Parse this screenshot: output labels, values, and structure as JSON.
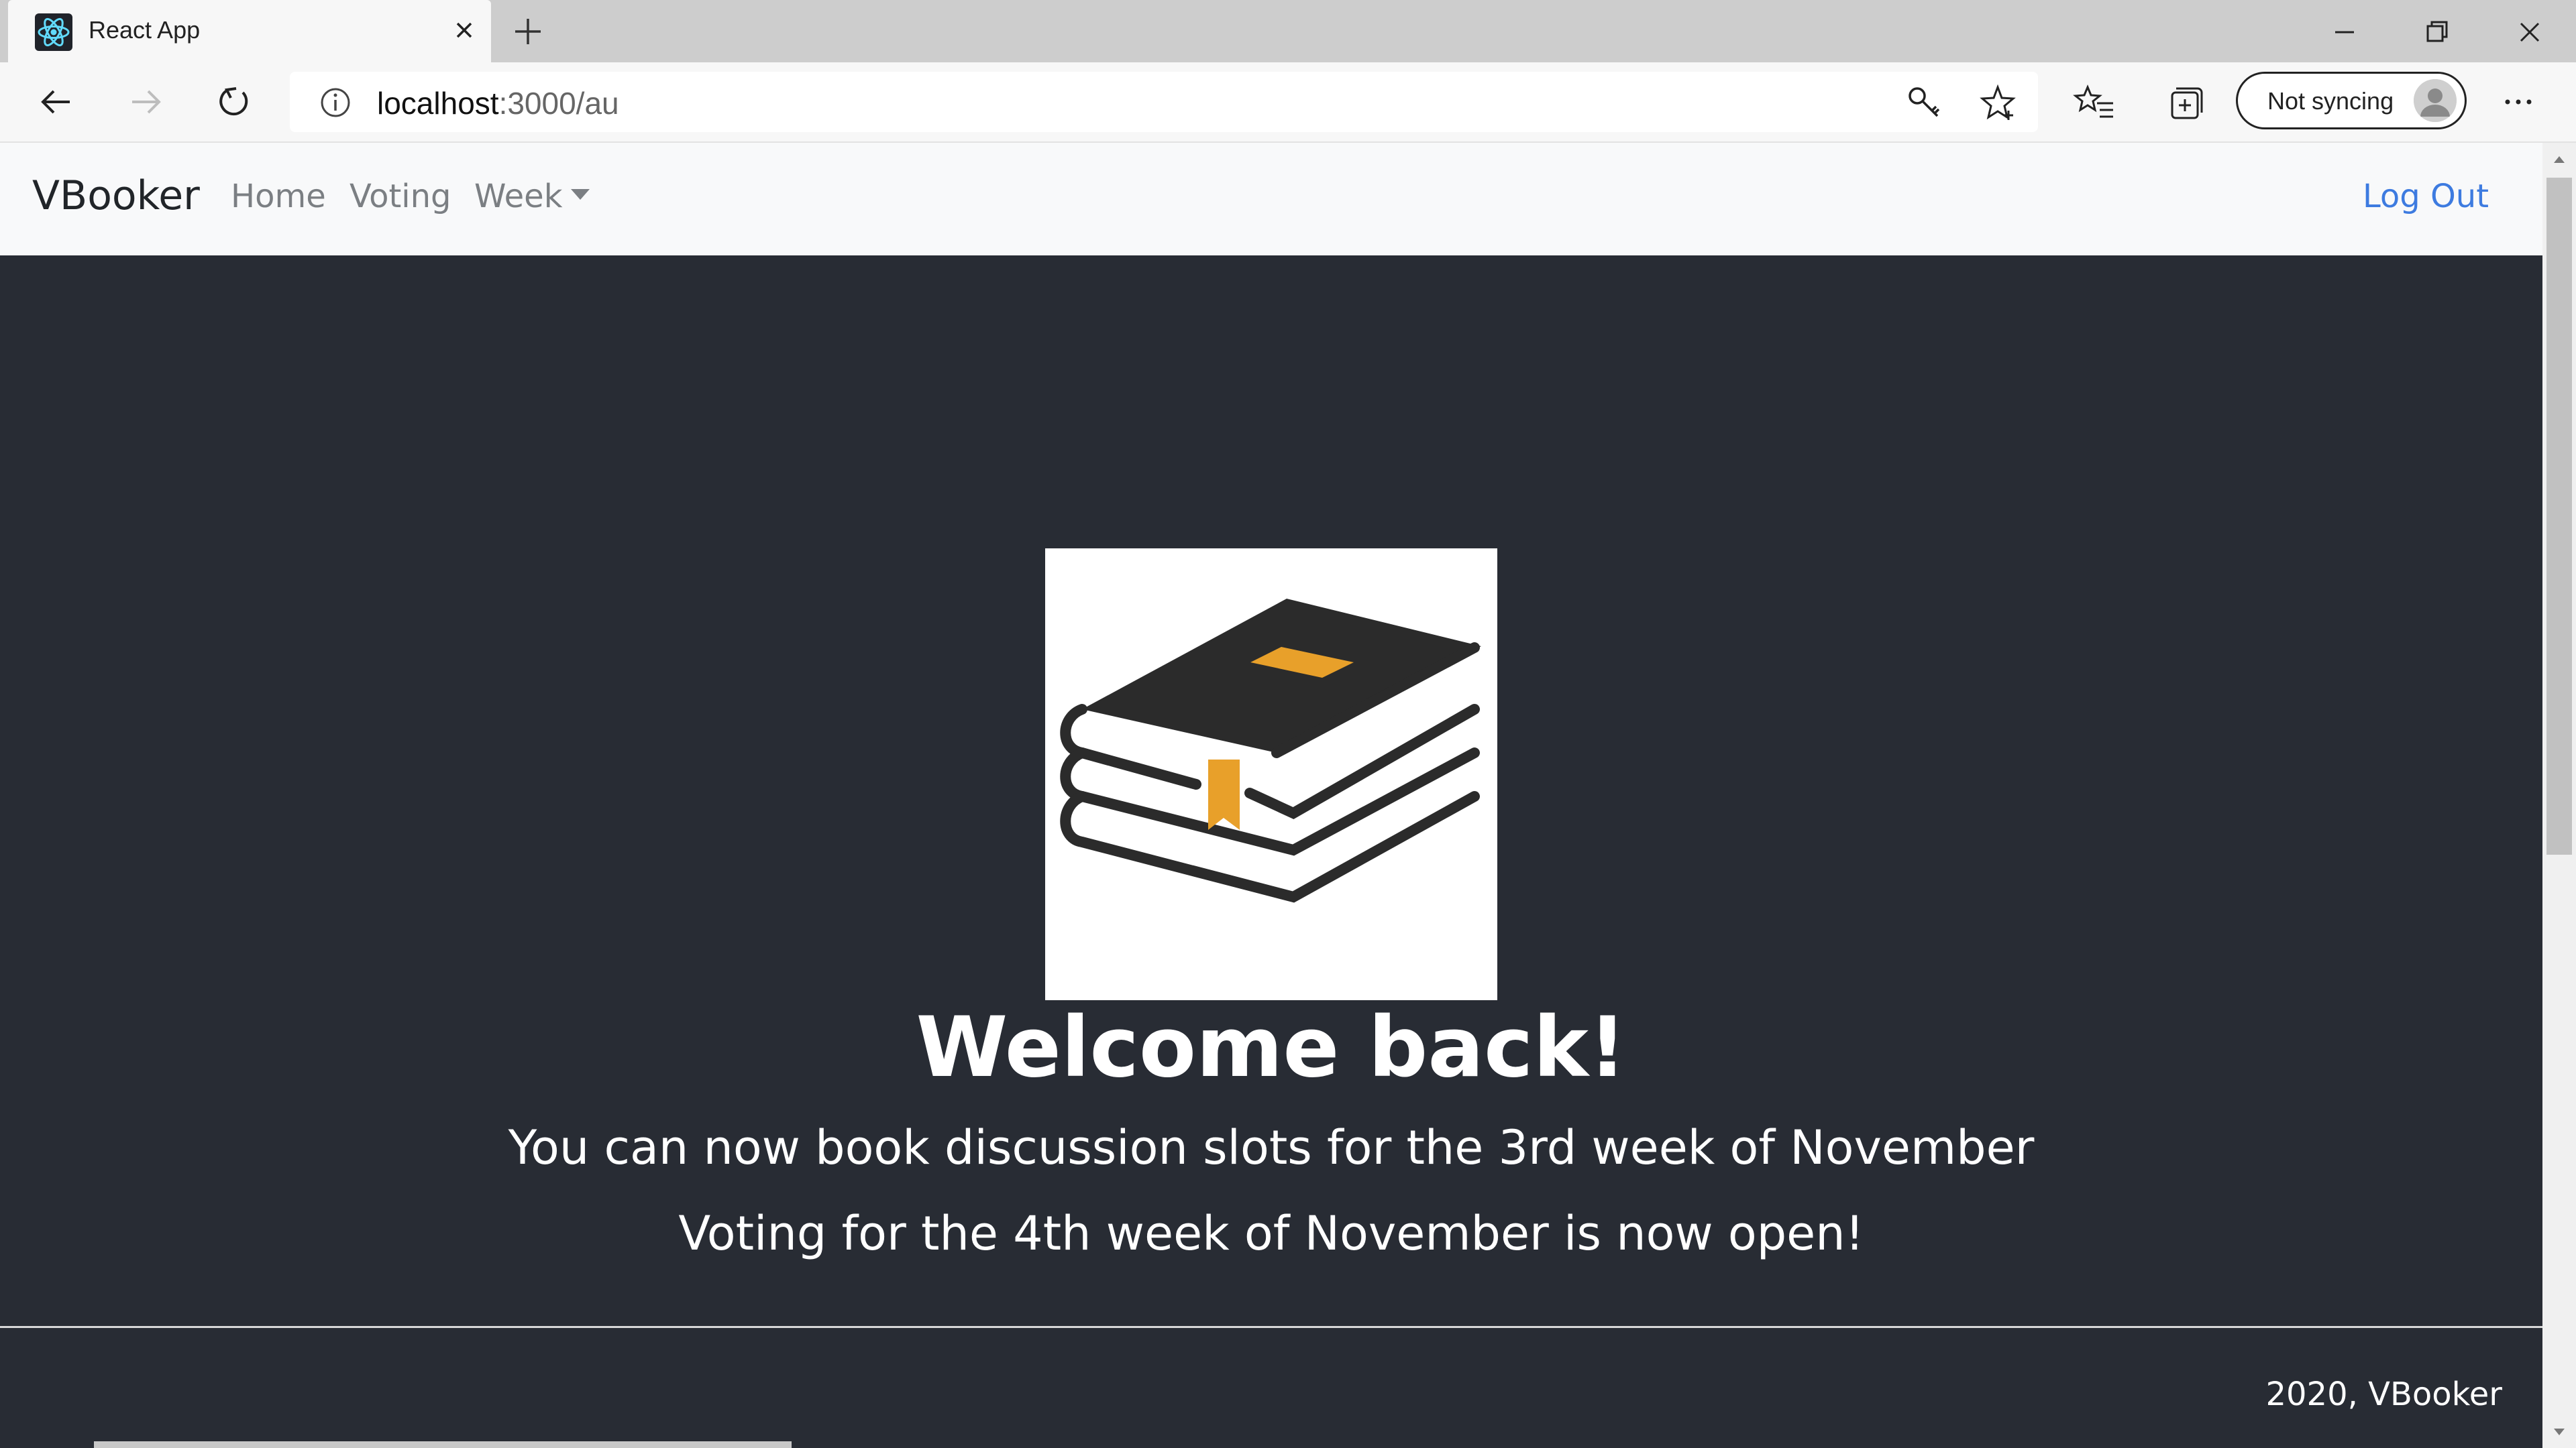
{
  "browser": {
    "tab_title": "React App",
    "url_host": "localhost",
    "url_rest": ":3000/au",
    "sync_label": "Not syncing"
  },
  "nav": {
    "brand": "VBooker",
    "links": [
      "Home",
      "Voting",
      "Week"
    ],
    "logout": "Log Out"
  },
  "main": {
    "heading": "Welcome back!",
    "message1": "You can now book discussion slots for the 3rd week of November",
    "message2": "Voting for the 4th week of November is now open!"
  },
  "footer": {
    "copyright": "2020, VBooker"
  },
  "colors": {
    "page_bg": "#282c34",
    "link_accent": "#3d7be0",
    "bookmark_accent": "#e8a02a"
  },
  "icons": [
    "react-icon",
    "close-icon",
    "plus-icon",
    "back-arrow-icon",
    "forward-arrow-icon",
    "refresh-icon",
    "info-icon",
    "key-icon",
    "star-icon",
    "favorites-icon",
    "collections-icon",
    "user-icon",
    "more-icon",
    "minimize-icon",
    "restore-icon",
    "window-close-icon"
  ]
}
